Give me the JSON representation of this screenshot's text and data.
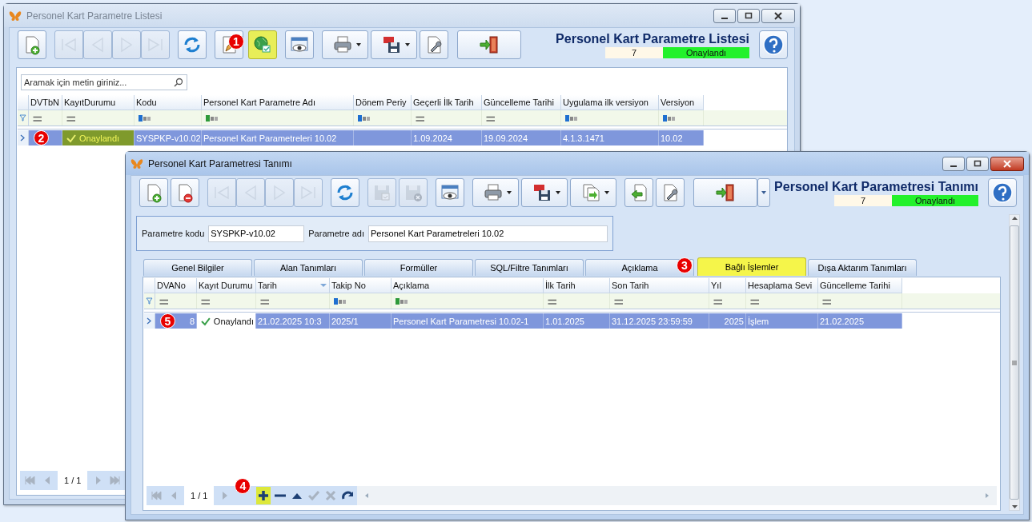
{
  "windows": [
    {
      "title": "Personel Kart Parametre Listesi",
      "active": false,
      "toolbar": [
        {
          "kind": "new",
          "disabled": false,
          "highlighted": false
        },
        {
          "kind": "first",
          "disabled": true,
          "highlighted": false
        },
        {
          "kind": "prev",
          "disabled": true,
          "highlighted": false
        },
        {
          "kind": "next",
          "disabled": true,
          "highlighted": false
        },
        {
          "kind": "last",
          "disabled": true,
          "highlighted": false
        },
        {
          "kind": "refresh",
          "disabled": false,
          "highlighted": false
        },
        {
          "kind": "edit",
          "disabled": false,
          "highlighted": false
        },
        {
          "kind": "approve",
          "disabled": false,
          "highlighted": true,
          "callout": "1"
        },
        {
          "kind": "preview",
          "disabled": false,
          "highlighted": false
        },
        {
          "kind": "print",
          "disabled": false,
          "highlighted": false
        },
        {
          "kind": "pdf",
          "disabled": false,
          "highlighted": false
        },
        {
          "kind": "tools",
          "disabled": false,
          "highlighted": false
        },
        {
          "kind": "exit",
          "disabled": false,
          "highlighted": false
        }
      ],
      "header": {
        "title": "Personel Kart Parametre Listesi",
        "count": "7",
        "status": "Onaylandı"
      },
      "search": {
        "placeholder": "Aramak için metin giriniz..."
      },
      "grid": {
        "columns": [
          {
            "label": "DVTbN",
            "filter": {
              "kind": "equals"
            }
          },
          {
            "label": "KayıtDurumu",
            "filter": {
              "kind": "equals"
            }
          },
          {
            "label": "Kodu",
            "filter": {
              "kind": "abc"
            }
          },
          {
            "label": "Personel Kart Parametre Adı",
            "filter": {
              "kind": "abcgreen"
            }
          },
          {
            "label": "Dönem Periy",
            "filter": {
              "kind": "abc"
            }
          },
          {
            "label": "Geçerli İlk Tarih",
            "filter": {
              "kind": "equals"
            }
          },
          {
            "label": "Güncelleme Tarihi",
            "filter": {
              "kind": "equals"
            }
          },
          {
            "label": "Uygulama ilk versiyon",
            "filter": {
              "kind": "abc"
            }
          },
          {
            "label": "Versiyon",
            "filter": {
              "kind": "abc"
            }
          }
        ],
        "rows": [
          {
            "selected": true,
            "cells": [
              {
                "kind": "text",
                "text": "",
                "callout": "2"
              },
              {
                "kind": "status",
                "text": "Onaylandı",
                "highlighted": true
              },
              {
                "kind": "text",
                "text": "SYSPKP-v10.02"
              },
              {
                "kind": "text",
                "text": "Personel Kart Parametreleri 10.02"
              },
              {
                "kind": "text",
                "text": ""
              },
              {
                "kind": "text",
                "text": "1.09.2024"
              },
              {
                "kind": "text",
                "text": "19.09.2024"
              },
              {
                "kind": "text",
                "text": "4.1.3.1471"
              },
              {
                "kind": "text",
                "text": "10.02"
              }
            ]
          }
        ]
      },
      "pager": {
        "page": "1 / 1",
        "buttons": [
          {
            "kind": "first",
            "disabled": true,
            "highlighted": false
          },
          {
            "kind": "prev",
            "disabled": true,
            "highlighted": false
          },
          {
            "kind": "page"
          },
          {
            "kind": "next",
            "disabled": true,
            "highlighted": false
          },
          {
            "kind": "last",
            "disabled": true,
            "highlighted": false
          }
        ]
      }
    },
    {
      "title": "Personel Kart Parametresi Tanımı",
      "active": true,
      "toolbar": [
        {
          "kind": "new",
          "disabled": false,
          "highlighted": false
        },
        {
          "kind": "delete",
          "disabled": false,
          "highlighted": false
        },
        {
          "kind": "first",
          "disabled": true,
          "highlighted": false
        },
        {
          "kind": "prev",
          "disabled": true,
          "highlighted": false
        },
        {
          "kind": "next",
          "disabled": true,
          "highlighted": false
        },
        {
          "kind": "last",
          "disabled": true,
          "highlighted": false
        },
        {
          "kind": "refresh",
          "disabled": false,
          "highlighted": false
        },
        {
          "kind": "save",
          "disabled": true,
          "highlighted": false
        },
        {
          "kind": "save-cancel",
          "disabled": true,
          "highlighted": false
        },
        {
          "kind": "preview",
          "disabled": false,
          "highlighted": false
        },
        {
          "kind": "print",
          "disabled": false,
          "highlighted": false
        },
        {
          "kind": "pdf",
          "disabled": false,
          "highlighted": false
        },
        {
          "kind": "export",
          "disabled": false,
          "highlighted": false
        },
        {
          "kind": "import",
          "disabled": false,
          "highlighted": false
        },
        {
          "kind": "tools",
          "disabled": false,
          "highlighted": false
        },
        {
          "kind": "exit",
          "disabled": false,
          "highlighted": false
        }
      ],
      "header": {
        "title": "Personel Kart Parametresi Tanımı",
        "count": "7",
        "status": "Onaylandı"
      },
      "params": [
        {
          "label": "Parametre kodu",
          "value": "SYSPKP-v10.02"
        },
        {
          "label": "Parametre adı",
          "value": "Personel Kart Parametreleri 10.02"
        }
      ],
      "tabs": [
        {
          "label": "Genel Bilgiler",
          "selected": false
        },
        {
          "label": "Alan Tanımları",
          "selected": false
        },
        {
          "label": "Formüller",
          "selected": false
        },
        {
          "label": "SQL/Filtre Tanımları",
          "selected": false
        },
        {
          "label": "Açıklama",
          "selected": false
        },
        {
          "label": "Bağlı İşlemler",
          "selected": true,
          "callout": "3"
        },
        {
          "label": "Dışa Aktarım Tanımları",
          "selected": false
        }
      ],
      "grid": {
        "columns": [
          {
            "label": "DVANo",
            "filter": {
              "kind": "equals"
            },
            "align": {
              "kind": "right"
            }
          },
          {
            "label": "Kayıt Durumu",
            "filter": {
              "kind": "equals"
            }
          },
          {
            "label": "Tarih",
            "filter": {
              "kind": "equals"
            },
            "sort": {
              "kind": "asc"
            }
          },
          {
            "label": "Takip No",
            "filter": {
              "kind": "abc"
            }
          },
          {
            "label": "Açıklama",
            "filter": {
              "kind": "abcgreen"
            }
          },
          {
            "label": "İlk Tarih",
            "filter": {
              "kind": "equals"
            }
          },
          {
            "label": "Son Tarih",
            "filter": {
              "kind": "equals"
            }
          },
          {
            "label": "Yıl",
            "filter": {
              "kind": "equals"
            },
            "align": {
              "kind": "right"
            }
          },
          {
            "label": "Hesaplama Sevi",
            "filter": {
              "kind": "equals"
            }
          },
          {
            "label": "Güncelleme Tarihi",
            "filter": {
              "kind": "equals"
            }
          }
        ],
        "rows": [
          {
            "selected": true,
            "cells": [
              {
                "kind": "text",
                "text": "8",
                "callout": "5"
              },
              {
                "kind": "status",
                "text": "Onaylandı",
                "highlighted": false
              },
              {
                "kind": "text",
                "text": "21.02.2025 10:3"
              },
              {
                "kind": "text",
                "text": "2025/1"
              },
              {
                "kind": "text",
                "text": "Personel Kart Parametresi 10.02-1"
              },
              {
                "kind": "text",
                "text": "1.01.2025"
              },
              {
                "kind": "text",
                "text": "31.12.2025 23:59:59"
              },
              {
                "kind": "text",
                "text": "2025"
              },
              {
                "kind": "text",
                "text": "İşlem"
              },
              {
                "kind": "text",
                "text": "21.02.2025"
              }
            ]
          }
        ]
      },
      "pager": {
        "page": "1 / 1",
        "buttons": [
          {
            "kind": "first",
            "disabled": true,
            "highlighted": false
          },
          {
            "kind": "prev",
            "disabled": true,
            "highlighted": false
          },
          {
            "kind": "page"
          },
          {
            "kind": "next",
            "disabled": true,
            "highlighted": false
          },
          {
            "kind": "add",
            "disabled": false,
            "highlighted": true,
            "callout": "4"
          },
          {
            "kind": "remove",
            "disabled": false,
            "highlighted": false
          },
          {
            "kind": "up",
            "disabled": false,
            "highlighted": false
          },
          {
            "kind": "check",
            "disabled": true,
            "highlighted": false
          },
          {
            "kind": "cancel",
            "disabled": true,
            "highlighted": false
          },
          {
            "kind": "redo",
            "disabled": false,
            "highlighted": false
          }
        ]
      }
    }
  ]
}
